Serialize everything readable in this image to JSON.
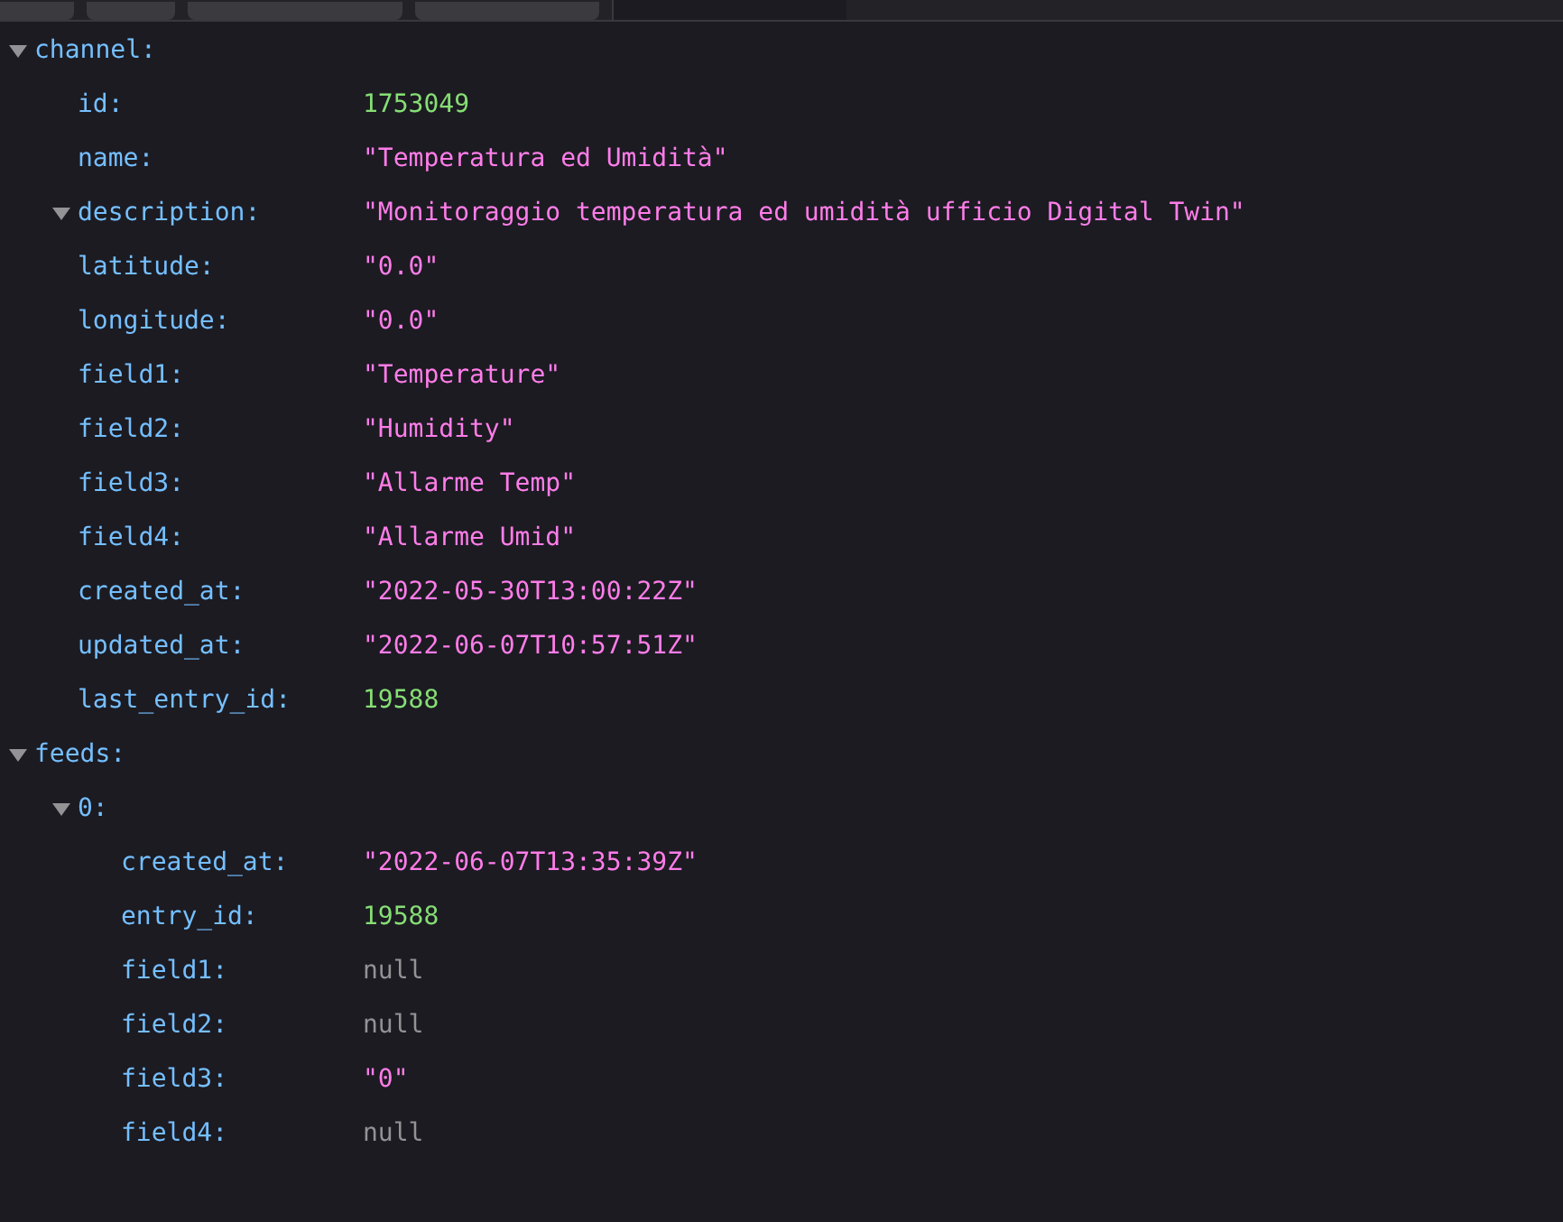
{
  "toolbar": {
    "buttons": [
      {
        "kind": "button"
      },
      {
        "kind": "button"
      },
      {
        "kind": "button"
      },
      {
        "kind": "button"
      }
    ],
    "filter": {
      "kind": "filter"
    }
  },
  "tree": [
    {
      "key": "channel:",
      "expanded": true,
      "children": [
        {
          "key": "id:",
          "value": "1753049",
          "kind": "number"
        },
        {
          "key": "name:",
          "value": "\"Temperatura ed Umidità\"",
          "kind": "string"
        },
        {
          "key": "description:",
          "value": "\"Monitoraggio temperatura ed umidità ufficio Digital Twin\"",
          "kind": "string",
          "expanded": true
        },
        {
          "key": "latitude:",
          "value": "\"0.0\"",
          "kind": "string"
        },
        {
          "key": "longitude:",
          "value": "\"0.0\"",
          "kind": "string"
        },
        {
          "key": "field1:",
          "value": "\"Temperature\"",
          "kind": "string"
        },
        {
          "key": "field2:",
          "value": "\"Humidity\"",
          "kind": "string"
        },
        {
          "key": "field3:",
          "value": "\"Allarme Temp\"",
          "kind": "string"
        },
        {
          "key": "field4:",
          "value": "\"Allarme Umid\"",
          "kind": "string"
        },
        {
          "key": "created_at:",
          "value": "\"2022-05-30T13:00:22Z\"",
          "kind": "string"
        },
        {
          "key": "updated_at:",
          "value": "\"2022-06-07T10:57:51Z\"",
          "kind": "string"
        },
        {
          "key": "last_entry_id:",
          "value": "19588",
          "kind": "number"
        }
      ]
    },
    {
      "key": "feeds:",
      "expanded": true,
      "children": [
        {
          "key": "0:",
          "expanded": true,
          "children": [
            {
              "key": "created_at:",
              "value": "\"2022-06-07T13:35:39Z\"",
              "kind": "string"
            },
            {
              "key": "entry_id:",
              "value": "19588",
              "kind": "number"
            },
            {
              "key": "field1:",
              "value": "null",
              "kind": "null"
            },
            {
              "key": "field2:",
              "value": "null",
              "kind": "null"
            },
            {
              "key": "field3:",
              "value": "\"0\"",
              "kind": "string"
            },
            {
              "key": "field4:",
              "value": "null",
              "kind": "null"
            }
          ]
        }
      ]
    }
  ]
}
